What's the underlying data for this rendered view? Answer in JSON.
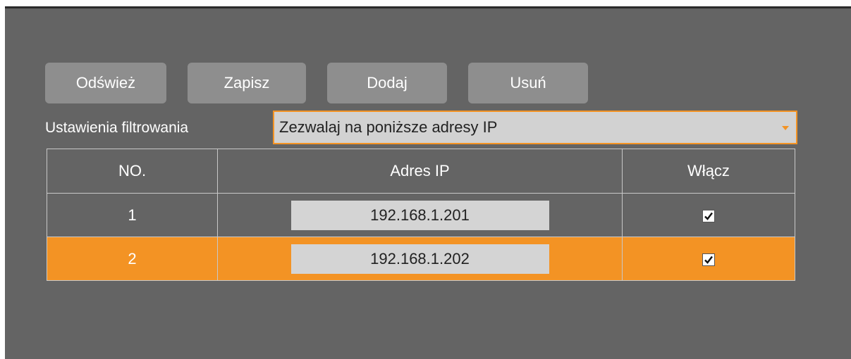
{
  "toolbar": {
    "refresh_label": "Odśwież",
    "save_label": "Zapisz",
    "add_label": "Dodaj",
    "remove_label": "Usuń"
  },
  "filter": {
    "label": "Ustawienia filtrowania",
    "selected": "Zezwalaj na poniższe adresy IP"
  },
  "table": {
    "headers": [
      "NO.",
      "Adres IP",
      "Włącz"
    ],
    "rows": [
      {
        "no": "1",
        "ip": "192.168.1.201",
        "enabled": true,
        "selected": false
      },
      {
        "no": "2",
        "ip": "192.168.1.202",
        "enabled": true,
        "selected": true
      }
    ]
  },
  "colors": {
    "panel_bg": "#646464",
    "button_bg": "#8e8e8e",
    "accent": "#f39324",
    "field_bg": "#d2d2d2"
  }
}
